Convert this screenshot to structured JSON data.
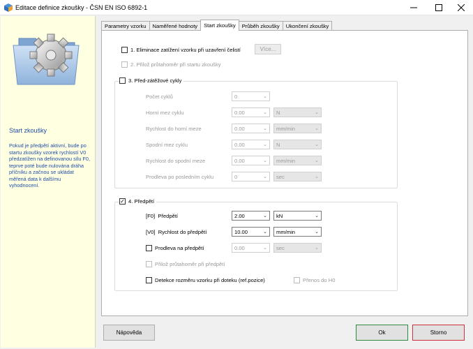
{
  "window": {
    "title": "Editace definice zkoušky - ČSN EN ISO 6892-1",
    "minimize_icon": "minimize-icon",
    "maximize_icon": "maximize-icon",
    "close_icon": "close-icon"
  },
  "sidebar": {
    "heading": "Start zkoušky",
    "description": "Pokud je předpětí aktivní, bude po startu zkoušky vzorek rychlostí V0 předzatížen na definovanou sílu F0, teprve poté bude nulována dráha příčníku a začnou se ukládat měřená data k dalšímu vyhodnocení."
  },
  "tabs": [
    {
      "label": "Parametry vzorku"
    },
    {
      "label": "Naměřené hodnoty"
    },
    {
      "label": "Start zkoušky",
      "active": true
    },
    {
      "label": "Průběh zkoušky"
    },
    {
      "label": "Ukončení zkoušky"
    }
  ],
  "opt1": {
    "label": "1. Eliminace zatížení vzorku při uzavření čelistí",
    "checked": false,
    "more_label": "Více..."
  },
  "opt2": {
    "label": "2. Přilož průtahoměr při startu zkoušky",
    "checked": false
  },
  "preload_cycles": {
    "title": "3. Před-zátěžové cykly",
    "checked": false,
    "fields": [
      {
        "label": "Počet cyklů",
        "value": "0"
      },
      {
        "label": "Horní mez cyklu",
        "value": "0.00",
        "unit": "N"
      },
      {
        "label": "Rychlost do horní meze",
        "value": "0.00",
        "unit": "mm/min"
      },
      {
        "label": "Spodní mez cyklu",
        "value": "0.00",
        "unit": "N"
      },
      {
        "label": "Rychlost do spodní meze",
        "value": "0.00",
        "unit": "mm/min"
      },
      {
        "label": "Prodleva po posledním cyklu",
        "value": "0",
        "unit": "sec"
      }
    ]
  },
  "preload": {
    "title": "4. Předpětí",
    "checked": true,
    "f0": {
      "tag": "[F0]",
      "label": "Předpětí",
      "value": "2.00",
      "unit": "kN"
    },
    "v0": {
      "tag": "[V0]",
      "label": "Rychlost do předpětí",
      "value": "10.00",
      "unit": "mm/min"
    },
    "dwell": {
      "label": "Prodleva na předpětí",
      "value": "0.00",
      "unit": "sec",
      "checked": false
    },
    "extensometer": {
      "label": "Přilož průtahoměr při předpětí",
      "checked": false
    },
    "detect": {
      "label": "Detekce rozměru vzorku při doteku (ref.pozice)",
      "checked": false
    },
    "transfer": {
      "label": "Přenos do H0",
      "checked": false
    }
  },
  "footer": {
    "help_label": "Nápověda",
    "ok_label": "Ok",
    "cancel_label": "Storno"
  }
}
